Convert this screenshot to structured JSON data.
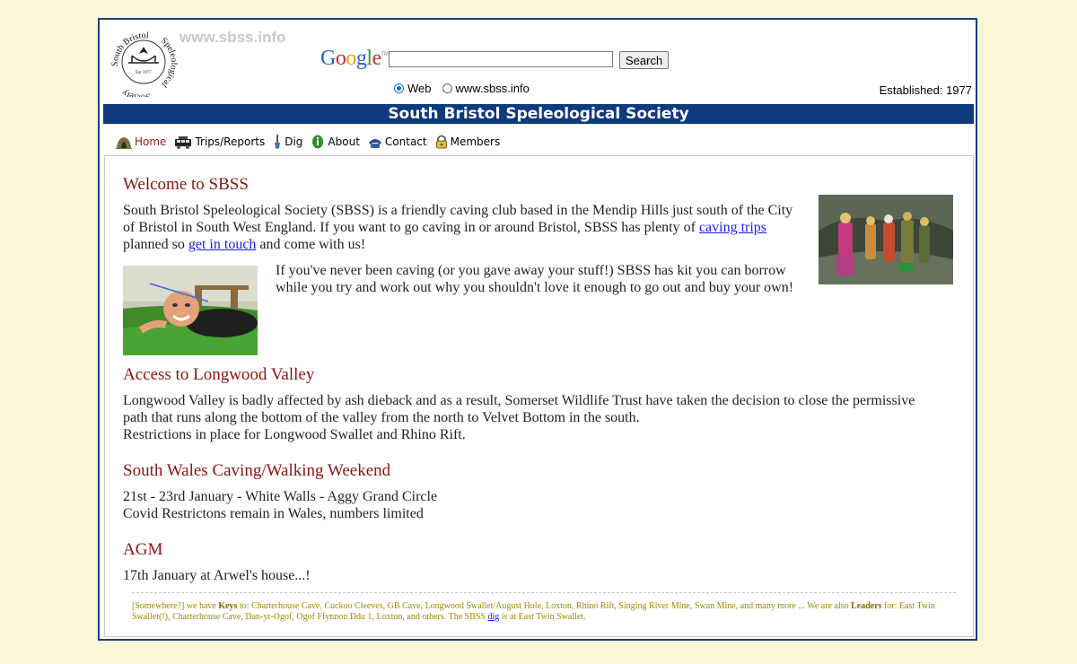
{
  "header": {
    "site_url": "www.sbss.info",
    "logo_text_top": "South Bristol",
    "logo_text_side": "Speleological",
    "logo_text_bottom": "Society",
    "logo_est": "Est 1977",
    "established": "Established: 1977"
  },
  "search": {
    "brand": "Google",
    "button_label": "Search",
    "input_value": "",
    "option_web": "Web",
    "option_site": "www.sbss.info"
  },
  "banner": {
    "title": "South Bristol Speleological Society"
  },
  "nav": {
    "items": [
      {
        "label": "Home"
      },
      {
        "label": "Trips/Reports"
      },
      {
        "label": "Dig"
      },
      {
        "label": "About"
      },
      {
        "label": "Contact"
      },
      {
        "label": "Members"
      }
    ]
  },
  "welcome": {
    "title": "Welcome to SBSS",
    "para1_a": "South Bristol Speleological Society (SBSS) is a friendly caving club based in the Mendip Hills just south of the City of Bristol in South West England. If you want to go caving in or around Bristol, SBSS has plenty of ",
    "link_trips": "caving trips",
    "para1_b": " planned so ",
    "link_contact": "get in touch",
    "para1_c": " and come with us!",
    "para2": "If you've never been caving (or you gave away your stuff!) SBSS has kit you can borrow while you try and work out why you shouldn't love it enough to go out and buy your own!"
  },
  "longwood": {
    "title": "Access to Longwood Valley",
    "line1": "Longwood Valley is badly affected by ash dieback and as a result, Somerset Wildlife Trust have taken the decision to close the permissive path that runs along the bottom of the valley from the north to Velvet Bottom in the south.",
    "line2": "Restrictions in place for Longwood Swallet and Rhino Rift."
  },
  "wales": {
    "title": "South Wales Caving/Walking Weekend",
    "line1": "21st - 23rd January - White Walls - Aggy Grand Circle",
    "line2": "Covid Restrictons remain in Wales, numbers limited"
  },
  "agm": {
    "title": "AGM",
    "line1": "17th January at Arwel's house...!"
  },
  "footer": {
    "prefix": "[Somewhere?] we have ",
    "keys_label": "Keys",
    "keys_text": " to: Charterhouse Cave, Cuckoo Cleeves, GB Cave, Longwood Swallet/August Hole, Loxton, Rhino Rift, Singing River Mine, Swan Mine, and many more ... We are also ",
    "leaders_label": "Leaders",
    "leaders_text": " for: East Twin Swallet(!), Charterhouse Cave, Dan-yr-Ogof, Ogof Ffynnon Ddu 1, Loxton, and others. The SBSS ",
    "dig_link": "dig",
    "suffix": " is at East Twin Swallet."
  },
  "colors": {
    "banner": "#0e3a7e",
    "heading": "#8b1414",
    "page_bg": "#fcf6d8",
    "footer_text": "#9a8a00"
  }
}
